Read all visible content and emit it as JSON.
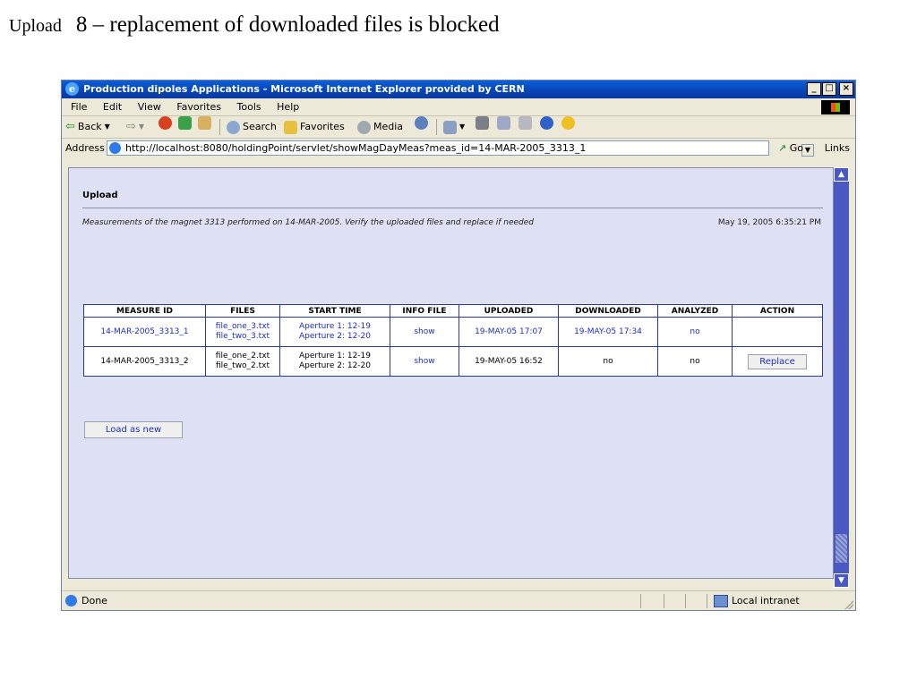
{
  "slide": {
    "title_small": "Upload",
    "title_main": "8 – replacement of downloaded files is blocked"
  },
  "window": {
    "title": "Production dipoles Applications - Microsoft Internet Explorer provided by CERN",
    "controls": {
      "minimize": "_",
      "maximize": "□",
      "close": "×"
    }
  },
  "menu": [
    "File",
    "Edit",
    "View",
    "Favorites",
    "Tools",
    "Help"
  ],
  "toolbar": {
    "back": "Back",
    "search": "Search",
    "favorites": "Favorites",
    "media": "Media"
  },
  "address": {
    "label": "Address",
    "url": "http://localhost:8080/holdingPoint/servlet/showMagDayMeas?meas_id=14-MAR-2005_3313_1",
    "go": "Go",
    "links": "Links"
  },
  "page": {
    "heading": "Upload",
    "intro": "Measurements of the magnet 3313 performed on 14-MAR-2005. Verify the uploaded files and replace if needed",
    "timestamp": "May 19, 2005 6:35:21 PM",
    "load_button": "Load as new"
  },
  "table": {
    "headers": [
      "MEASURE ID",
      "FILES",
      "START TIME",
      "INFO FILE",
      "UPLOADED",
      "DOWNLOADED",
      "ANALYZED",
      "ACTION"
    ],
    "rows": [
      {
        "measure_id": "14-MAR-2005_3313_1",
        "file1": "file_one_3.txt",
        "file2": "file_two_3.txt",
        "start1": "Aperture 1:   12-19",
        "start2": "Aperture 2:   12-20",
        "info": "show",
        "uploaded": "19-MAY-05 17:07",
        "downloaded": "19-MAY-05 17:34",
        "analyzed": "no",
        "action": ""
      },
      {
        "measure_id": "14-MAR-2005_3313_2",
        "file1": "file_one_2.txt",
        "file2": "file_two_2.txt",
        "start1": "Aperture 1:   12-19",
        "start2": "Aperture 2:   12-20",
        "info": "show",
        "uploaded": "19-MAY-05 16:52",
        "downloaded": "no",
        "analyzed": "no",
        "action": "Replace"
      }
    ]
  },
  "status": {
    "text": "Done",
    "zone": "Local intranet"
  },
  "colors": {
    "titlebar": "#0843b4",
    "content_bg": "#dde1f3",
    "link": "#1a2ec8",
    "scrollbar": "#4a58c4"
  }
}
